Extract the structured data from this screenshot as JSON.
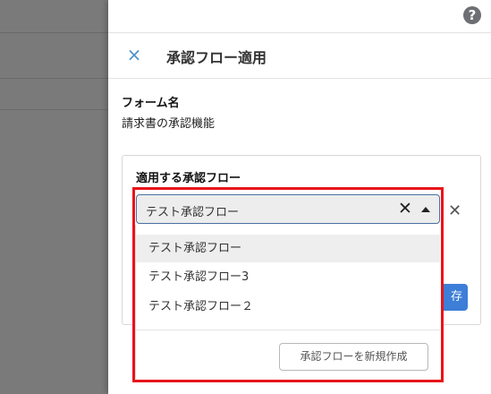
{
  "panel": {
    "title": "承認フロー適用",
    "form_name_label": "フォーム名",
    "form_name_value": "請求書の承認機能"
  },
  "approval_card": {
    "label": "適用する承認フロー",
    "save_button_label": "存"
  },
  "select": {
    "selected_value": "テスト承認フロー",
    "options": [
      "テスト承認フロー",
      "テスト承認フロー3",
      "テスト承認フロー２"
    ],
    "new_flow_button": "承認フローを新規作成"
  },
  "icons": {
    "help": "?",
    "close": "×",
    "clear": "✕"
  },
  "colors": {
    "highlight": "#e8141b",
    "primary": "#3d7ed8",
    "close_icon": "#4a90c8"
  }
}
